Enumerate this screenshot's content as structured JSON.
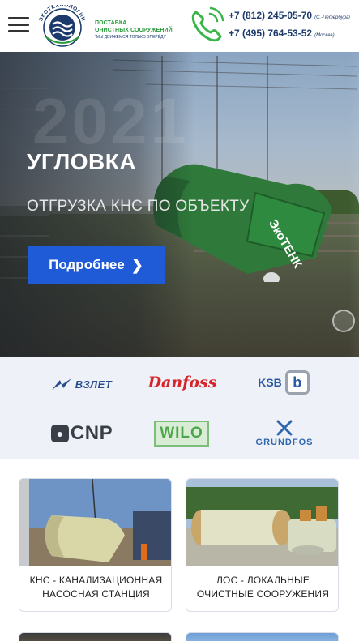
{
  "header": {
    "menu_icon": "hamburger-icon",
    "logo": {
      "ring_text": "ЭКОТЕХНОЛОГИИ",
      "line1": "ПОСТАВКА",
      "line2": "ОЧИСТНЫХ СООРУЖЕНИЙ",
      "slogan": "\"МЫ ДВИЖЕМСЯ ТОЛЬКО ВПЕРЁД!\"",
      "color": "#2a9a3a"
    },
    "phone_icon": "phone-ringing-icon",
    "phones": [
      {
        "number": "+7 (812) 245-05-70",
        "city": "(С.-Петербург)"
      },
      {
        "number": "+7 (495) 764-53-52",
        "city": "(Москва)"
      }
    ]
  },
  "hero": {
    "year": "2021",
    "title": "УГЛОВКА",
    "subtitle": "ОТГРУЗКА КНС ПО ОБЪЕКТУ",
    "button_label": "Подробнее",
    "button_color": "#1f5bd6",
    "tank_brand": "ЭкоТЕНК"
  },
  "brands": [
    {
      "name": "ВЗЛЕТ"
    },
    {
      "name": "Danfoss"
    },
    {
      "name": "KSB",
      "mark": "b"
    },
    {
      "name": "CNP"
    },
    {
      "name": "WILO"
    },
    {
      "name": "GRUNDFOS"
    }
  ],
  "cards": [
    {
      "label_line1": "КНС - КАНАЛИЗАЦИОННАЯ",
      "label_line2": "НАСОСНАЯ СТАНЦИЯ"
    },
    {
      "label_line1": "ЛОС - ЛОКАЛЬНЫЕ",
      "label_line2": "ОЧИСТНЫЕ СООРУЖЕНИЯ"
    }
  ]
}
